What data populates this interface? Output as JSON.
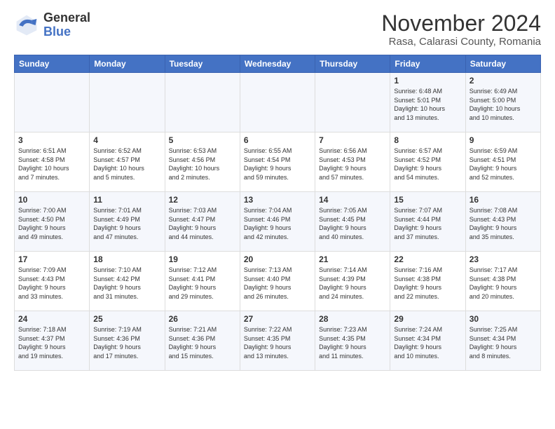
{
  "header": {
    "logo_general": "General",
    "logo_blue": "Blue",
    "main_title": "November 2024",
    "sub_title": "Rasa, Calarasi County, Romania"
  },
  "days_of_week": [
    "Sunday",
    "Monday",
    "Tuesday",
    "Wednesday",
    "Thursday",
    "Friday",
    "Saturday"
  ],
  "weeks": [
    [
      {
        "day": "",
        "info": ""
      },
      {
        "day": "",
        "info": ""
      },
      {
        "day": "",
        "info": ""
      },
      {
        "day": "",
        "info": ""
      },
      {
        "day": "",
        "info": ""
      },
      {
        "day": "1",
        "info": "Sunrise: 6:48 AM\nSunset: 5:01 PM\nDaylight: 10 hours\nand 13 minutes."
      },
      {
        "day": "2",
        "info": "Sunrise: 6:49 AM\nSunset: 5:00 PM\nDaylight: 10 hours\nand 10 minutes."
      }
    ],
    [
      {
        "day": "3",
        "info": "Sunrise: 6:51 AM\nSunset: 4:58 PM\nDaylight: 10 hours\nand 7 minutes."
      },
      {
        "day": "4",
        "info": "Sunrise: 6:52 AM\nSunset: 4:57 PM\nDaylight: 10 hours\nand 5 minutes."
      },
      {
        "day": "5",
        "info": "Sunrise: 6:53 AM\nSunset: 4:56 PM\nDaylight: 10 hours\nand 2 minutes."
      },
      {
        "day": "6",
        "info": "Sunrise: 6:55 AM\nSunset: 4:54 PM\nDaylight: 9 hours\nand 59 minutes."
      },
      {
        "day": "7",
        "info": "Sunrise: 6:56 AM\nSunset: 4:53 PM\nDaylight: 9 hours\nand 57 minutes."
      },
      {
        "day": "8",
        "info": "Sunrise: 6:57 AM\nSunset: 4:52 PM\nDaylight: 9 hours\nand 54 minutes."
      },
      {
        "day": "9",
        "info": "Sunrise: 6:59 AM\nSunset: 4:51 PM\nDaylight: 9 hours\nand 52 minutes."
      }
    ],
    [
      {
        "day": "10",
        "info": "Sunrise: 7:00 AM\nSunset: 4:50 PM\nDaylight: 9 hours\nand 49 minutes."
      },
      {
        "day": "11",
        "info": "Sunrise: 7:01 AM\nSunset: 4:49 PM\nDaylight: 9 hours\nand 47 minutes."
      },
      {
        "day": "12",
        "info": "Sunrise: 7:03 AM\nSunset: 4:47 PM\nDaylight: 9 hours\nand 44 minutes."
      },
      {
        "day": "13",
        "info": "Sunrise: 7:04 AM\nSunset: 4:46 PM\nDaylight: 9 hours\nand 42 minutes."
      },
      {
        "day": "14",
        "info": "Sunrise: 7:05 AM\nSunset: 4:45 PM\nDaylight: 9 hours\nand 40 minutes."
      },
      {
        "day": "15",
        "info": "Sunrise: 7:07 AM\nSunset: 4:44 PM\nDaylight: 9 hours\nand 37 minutes."
      },
      {
        "day": "16",
        "info": "Sunrise: 7:08 AM\nSunset: 4:43 PM\nDaylight: 9 hours\nand 35 minutes."
      }
    ],
    [
      {
        "day": "17",
        "info": "Sunrise: 7:09 AM\nSunset: 4:43 PM\nDaylight: 9 hours\nand 33 minutes."
      },
      {
        "day": "18",
        "info": "Sunrise: 7:10 AM\nSunset: 4:42 PM\nDaylight: 9 hours\nand 31 minutes."
      },
      {
        "day": "19",
        "info": "Sunrise: 7:12 AM\nSunset: 4:41 PM\nDaylight: 9 hours\nand 29 minutes."
      },
      {
        "day": "20",
        "info": "Sunrise: 7:13 AM\nSunset: 4:40 PM\nDaylight: 9 hours\nand 26 minutes."
      },
      {
        "day": "21",
        "info": "Sunrise: 7:14 AM\nSunset: 4:39 PM\nDaylight: 9 hours\nand 24 minutes."
      },
      {
        "day": "22",
        "info": "Sunrise: 7:16 AM\nSunset: 4:38 PM\nDaylight: 9 hours\nand 22 minutes."
      },
      {
        "day": "23",
        "info": "Sunrise: 7:17 AM\nSunset: 4:38 PM\nDaylight: 9 hours\nand 20 minutes."
      }
    ],
    [
      {
        "day": "24",
        "info": "Sunrise: 7:18 AM\nSunset: 4:37 PM\nDaylight: 9 hours\nand 19 minutes."
      },
      {
        "day": "25",
        "info": "Sunrise: 7:19 AM\nSunset: 4:36 PM\nDaylight: 9 hours\nand 17 minutes."
      },
      {
        "day": "26",
        "info": "Sunrise: 7:21 AM\nSunset: 4:36 PM\nDaylight: 9 hours\nand 15 minutes."
      },
      {
        "day": "27",
        "info": "Sunrise: 7:22 AM\nSunset: 4:35 PM\nDaylight: 9 hours\nand 13 minutes."
      },
      {
        "day": "28",
        "info": "Sunrise: 7:23 AM\nSunset: 4:35 PM\nDaylight: 9 hours\nand 11 minutes."
      },
      {
        "day": "29",
        "info": "Sunrise: 7:24 AM\nSunset: 4:34 PM\nDaylight: 9 hours\nand 10 minutes."
      },
      {
        "day": "30",
        "info": "Sunrise: 7:25 AM\nSunset: 4:34 PM\nDaylight: 9 hours\nand 8 minutes."
      }
    ]
  ]
}
